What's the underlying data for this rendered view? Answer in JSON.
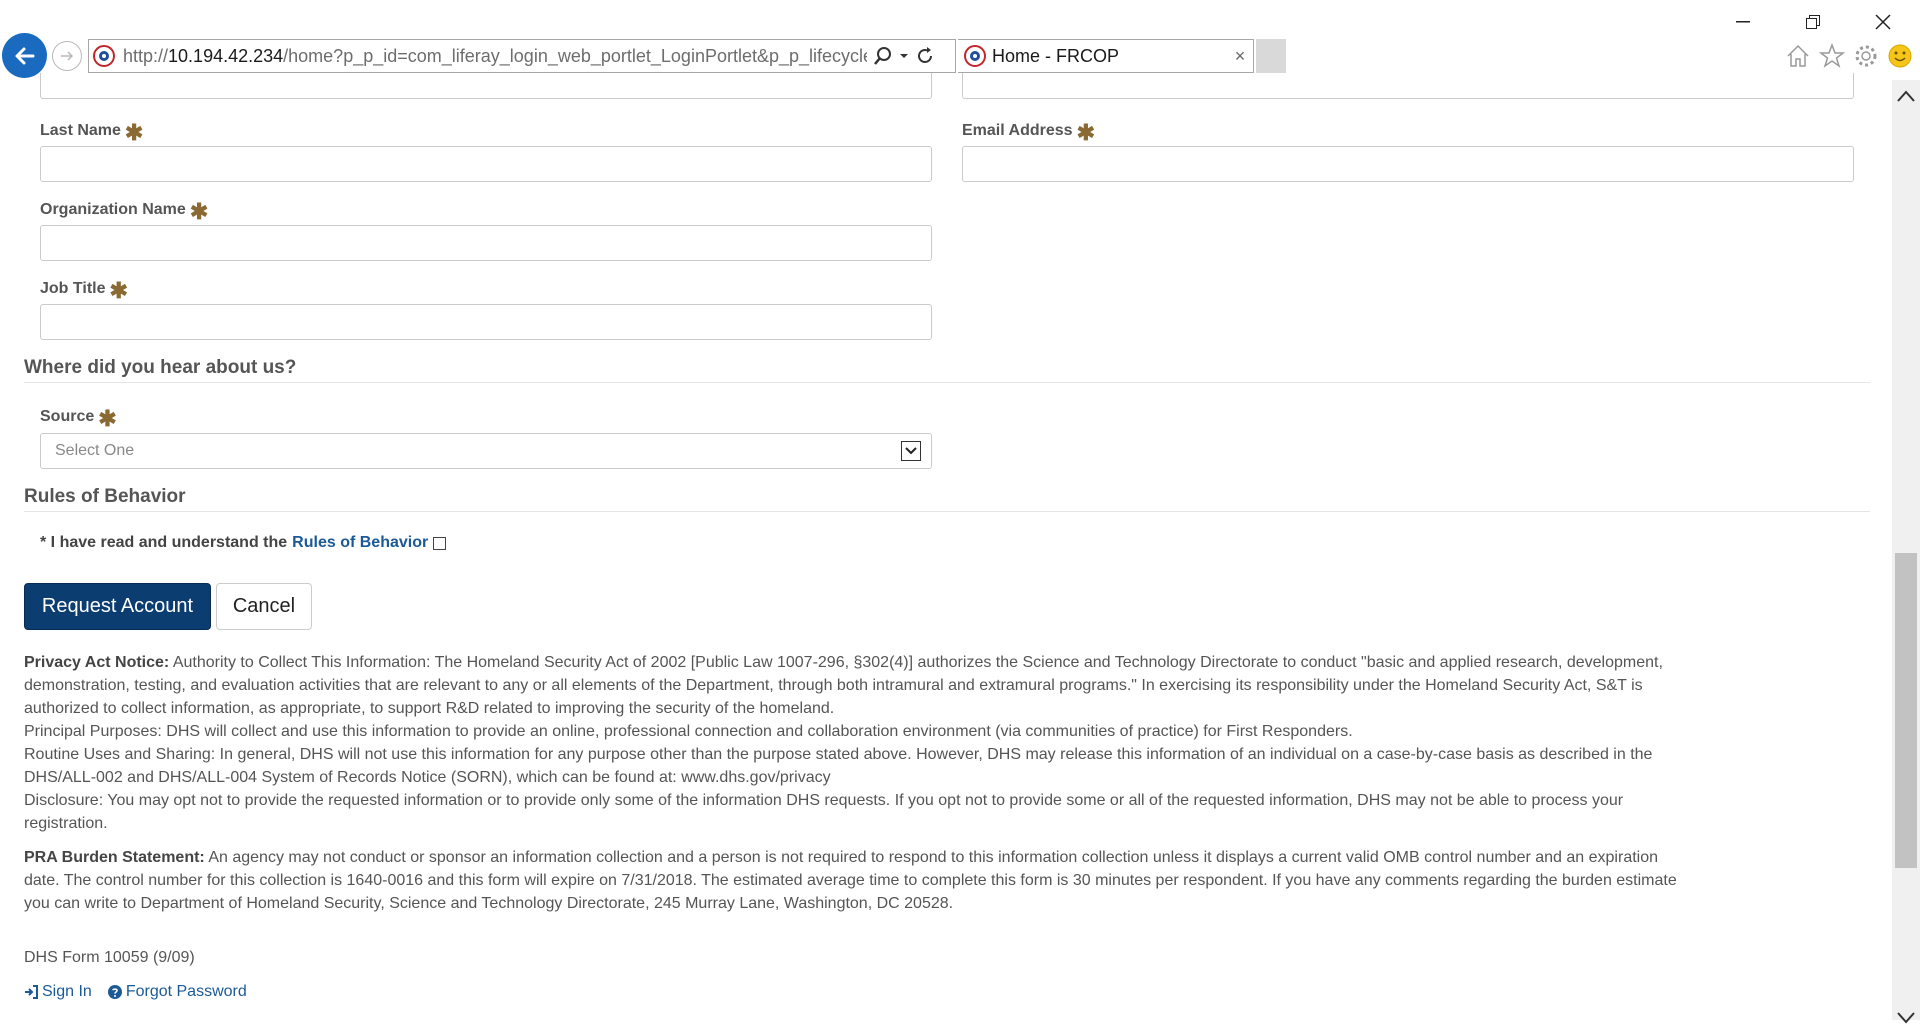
{
  "browser": {
    "url_prefix": "http://",
    "url_host": "10.194.42.234",
    "url_path": "/home?p_p_id=com_liferay_login_web_portlet_LoginPortlet&p_p_lifecycle=(",
    "tab_title": "Home - FRCOP",
    "tab_close": "×",
    "accent": "#1a6bbf"
  },
  "form": {
    "last_name_label": "Last Name",
    "email_label": "Email Address",
    "org_label": "Organization Name",
    "job_label": "Job Title",
    "req_star": "✱"
  },
  "source_section": {
    "title": "Where did you hear about us?",
    "source_label": "Source",
    "select_value": "Select One"
  },
  "rules_section": {
    "title": "Rules of Behavior",
    "prefix": "* I have read and understand the",
    "link": "Rules of Behavior"
  },
  "buttons": {
    "request": "Request Account",
    "cancel": "Cancel",
    "primary_color": "#0b3d70"
  },
  "privacy": {
    "heading": "Privacy Act Notice:",
    "authority": "Authority to Collect This Information: The Homeland Security Act of 2002 [Public Law 1007-296, §302(4)] authorizes the Science and Technology Directorate to conduct \"basic and applied research, development, demonstration, testing, and evaluation activities that are relevant to any or all elements of the Department, through both intramural and extramural programs.\" In exercising its responsibility under the Homeland Security Act, S&T is authorized to collect information, as appropriate, to support R&D related to improving the security of the homeland.",
    "purposes": "Principal Purposes: DHS will collect and use this information to provide an online, professional connection and collaboration environment (via communities of practice) for First Responders.",
    "routine": "Routine Uses and Sharing: In general, DHS will not use this information for any purpose other than the purpose stated above. However, DHS may release this information of an individual on a case-by-case basis as described in the DHS/ALL-002 and DHS/ALL-004 System of Records Notice (SORN), which can be found at: www.dhs.gov/privacy",
    "disclosure": "Disclosure: You may opt not to provide the requested information or to provide only some of the information DHS requests. If you opt not to provide some or all of the requested information, DHS may not be able to process your registration."
  },
  "pra": {
    "heading": "PRA Burden Statement:",
    "text": "An agency may not conduct or sponsor an information collection and a person is not required to respond to this information collection unless it displays a current valid OMB control number and an expiration date. The control number for this collection is 1640-0016 and this form will expire on 7/31/2018. The estimated average time to complete this form is 30 minutes per respondent. If you have any comments regarding the burden estimate you can write to Department of Homeland Security, Science and Technology Directorate, 245 Murray Lane, Washington, DC 20528."
  },
  "footer": {
    "form_number": "DHS Form 10059 (9/09)",
    "sign_in": "Sign In",
    "forgot": "Forgot Password"
  }
}
